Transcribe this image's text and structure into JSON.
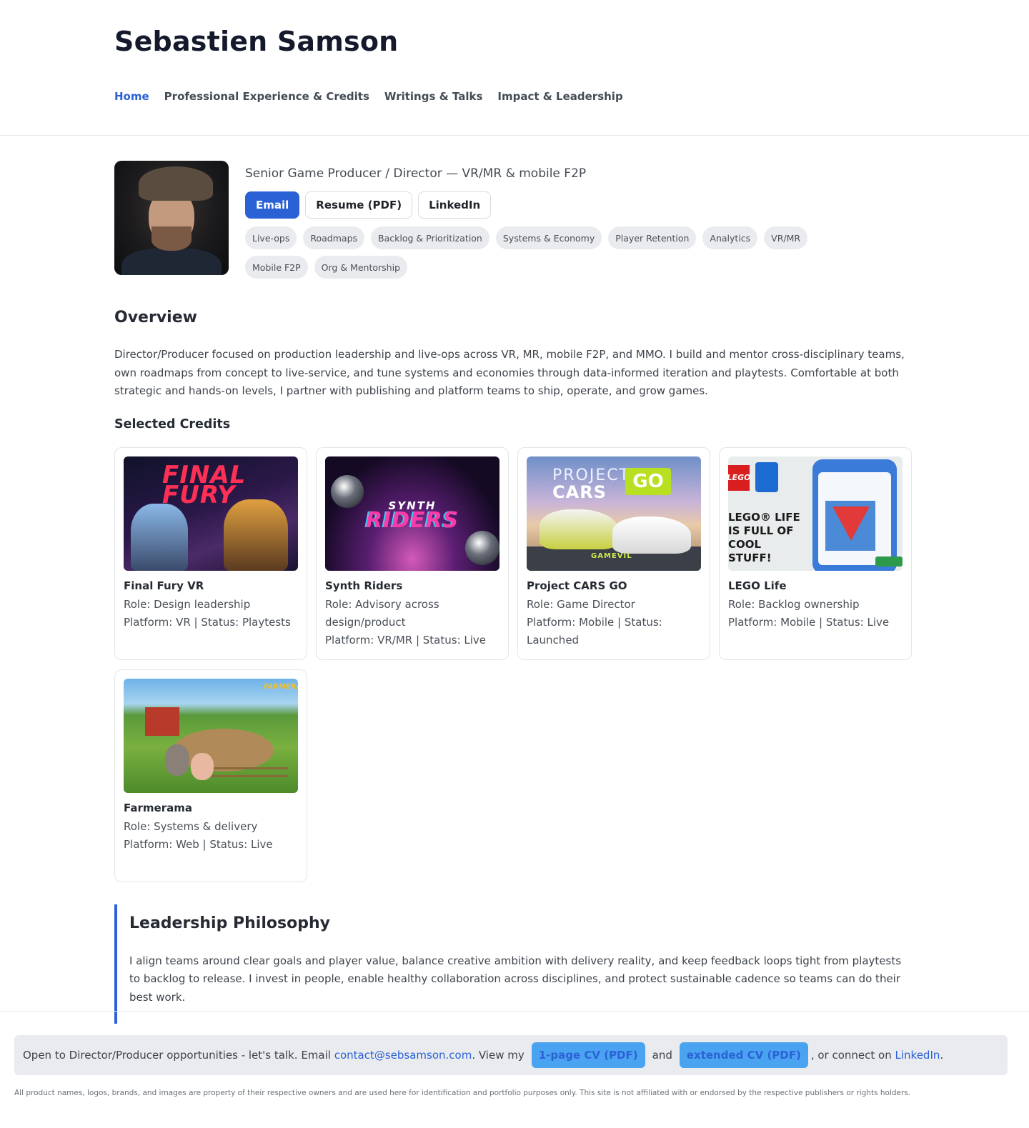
{
  "site": {
    "title": "Sebastien Samson"
  },
  "nav": [
    {
      "label": "Home",
      "active": true
    },
    {
      "label": "Professional Experience & Credits"
    },
    {
      "label": "Writings & Talks"
    },
    {
      "label": "Impact & Leadership"
    }
  ],
  "hero": {
    "subtitle": "Senior Game Producer / Director — VR/MR & mobile F2P",
    "buttons": {
      "email": "Email",
      "resume": "Resume (PDF)",
      "linkedin": "LinkedIn"
    },
    "tags": [
      "Live-ops",
      "Roadmaps",
      "Backlog & Prioritization",
      "Systems & Economy",
      "Player Retention",
      "Analytics",
      "VR/MR",
      "Mobile F2P",
      "Org & Mentorship"
    ]
  },
  "overview": {
    "heading": "Overview",
    "text": "Director/Producer focused on production leadership and live-ops across VR, MR, mobile F2P, and MMO. I build and mentor cross-disciplinary teams, own roadmaps from concept to live-service, and tune systems and economies through data-informed iteration and playtests. Comfortable at both strategic and hands-on levels, I partner with publishing and platform teams to ship, operate, and grow games."
  },
  "credits": {
    "heading": "Selected Credits",
    "items": [
      {
        "title": "Final Fury VR",
        "role": "Role: Design leadership",
        "platform": "Platform: VR | Status: Playtests",
        "thumb_text": "FINAL FURY"
      },
      {
        "title": "Synth Riders",
        "role": "Role: Advisory across design/product",
        "platform": "Platform: VR/MR | Status: Live",
        "thumb_text_top": "SYNTH",
        "thumb_text_main": "RIDERS"
      },
      {
        "title": "Project CARS GO",
        "role": "Role: Game Director",
        "platform": "Platform: Mobile | Status: Launched",
        "thumb_t1": "PROJECT",
        "thumb_t2": "CARS",
        "thumb_go": "GO",
        "thumb_brand": "GAMEVIL"
      },
      {
        "title": "LEGO Life",
        "role": "Role: Backlog ownership",
        "platform": "Platform: Mobile | Status: Live",
        "thumb_brick": "LEGO",
        "thumb_text": "LEGO® LIFE IS FULL OF COOL STUFF!"
      },
      {
        "title": "Farmerama",
        "role": "Role: Systems & delivery",
        "platform": "Platform: Web | Status: Live",
        "thumb_logo": "FARMERAMA"
      }
    ]
  },
  "philosophy": {
    "heading": "Leadership Philosophy",
    "text": "I align teams around clear goals and player value, balance creative ambition with delivery reality, and keep feedback loops tight from playtests to backlog to release. I invest in people, enable healthy collaboration across disciplines, and protect sustainable cadence so teams can do their best work."
  },
  "footer": {
    "cta_prefix": "Open to Director/Producer opportunities - let's talk. Email ",
    "email": "contact@sebsamson.com",
    "cta_mid": ". View my",
    "cv_short": "1-page CV (PDF)",
    "and": "and",
    "cv_long": "extended CV (PDF)",
    "cta_connect": ", or connect on ",
    "linkedin": "LinkedIn",
    "period": ".",
    "legal": "All product names, logos, brands, and images are property of their respective owners and are used here for identification and portfolio purposes only. This site is not affiliated with or endorsed by the respective publishers or rights holders."
  },
  "colors": {
    "accent": "#2a62d6",
    "cta_pill": "#4aa3f0",
    "tag_bg": "#e9ebee"
  }
}
